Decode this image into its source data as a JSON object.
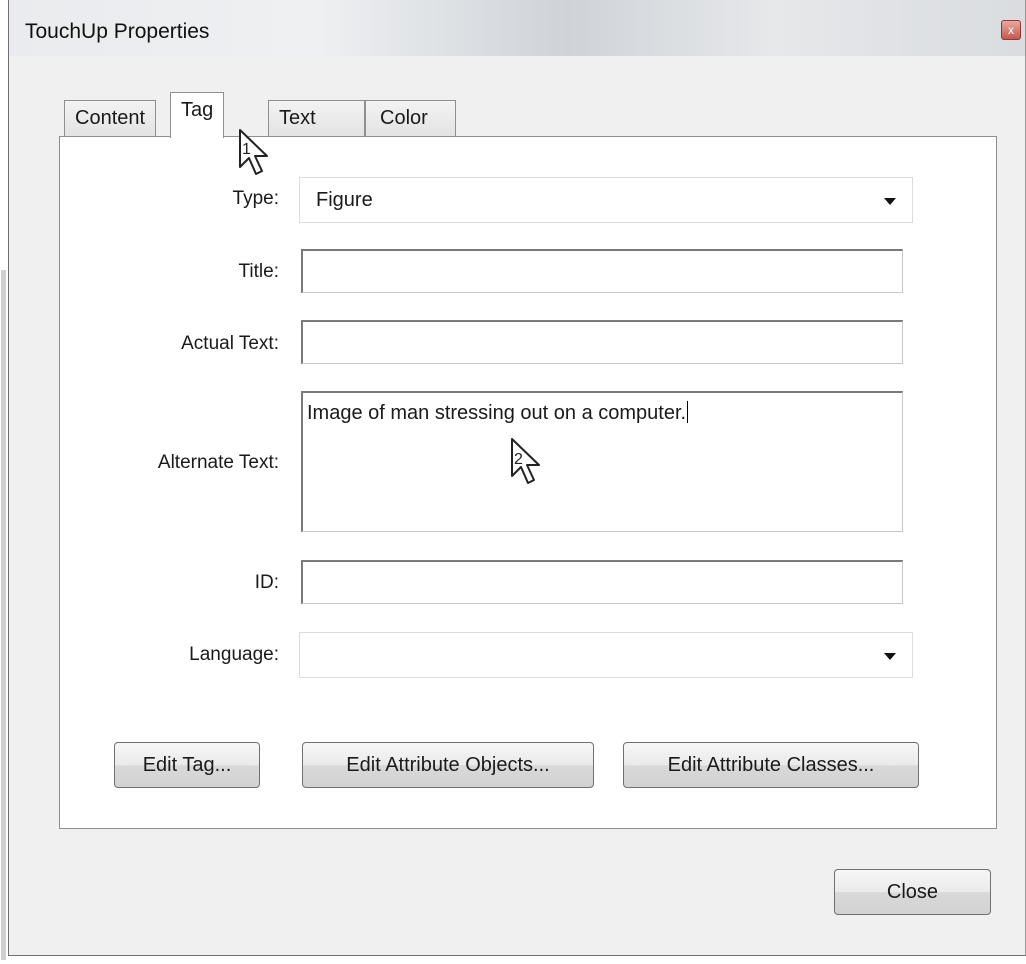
{
  "window": {
    "title": "TouchUp Properties",
    "close_glyph": "x"
  },
  "tabs": [
    {
      "label": "Content",
      "active": false
    },
    {
      "label": "Tag",
      "active": true
    },
    {
      "label": "Text",
      "active": false
    },
    {
      "label": "Color",
      "active": false
    }
  ],
  "form": {
    "type_label": "Type:",
    "type_value": "Figure",
    "title_label": "Title:",
    "title_value": "",
    "actual_text_label": "Actual Text:",
    "actual_text_value": "",
    "alternate_text_label": "Alternate Text:",
    "alternate_text_value": "Image of man stressing out on a computer.",
    "id_label": "ID:",
    "id_value": "",
    "language_label": "Language:",
    "language_value": ""
  },
  "buttons": {
    "edit_tag": "Edit Tag...",
    "edit_attribute_objects": "Edit Attribute Objects...",
    "edit_attribute_classes": "Edit Attribute Classes...",
    "close": "Close"
  },
  "annotations": {
    "cursor_1_label": "1",
    "cursor_2_label": "2"
  },
  "icons": {
    "close": "close-icon",
    "dropdown": "chevron-down-icon",
    "pointer": "arrow-cursor-icon"
  }
}
